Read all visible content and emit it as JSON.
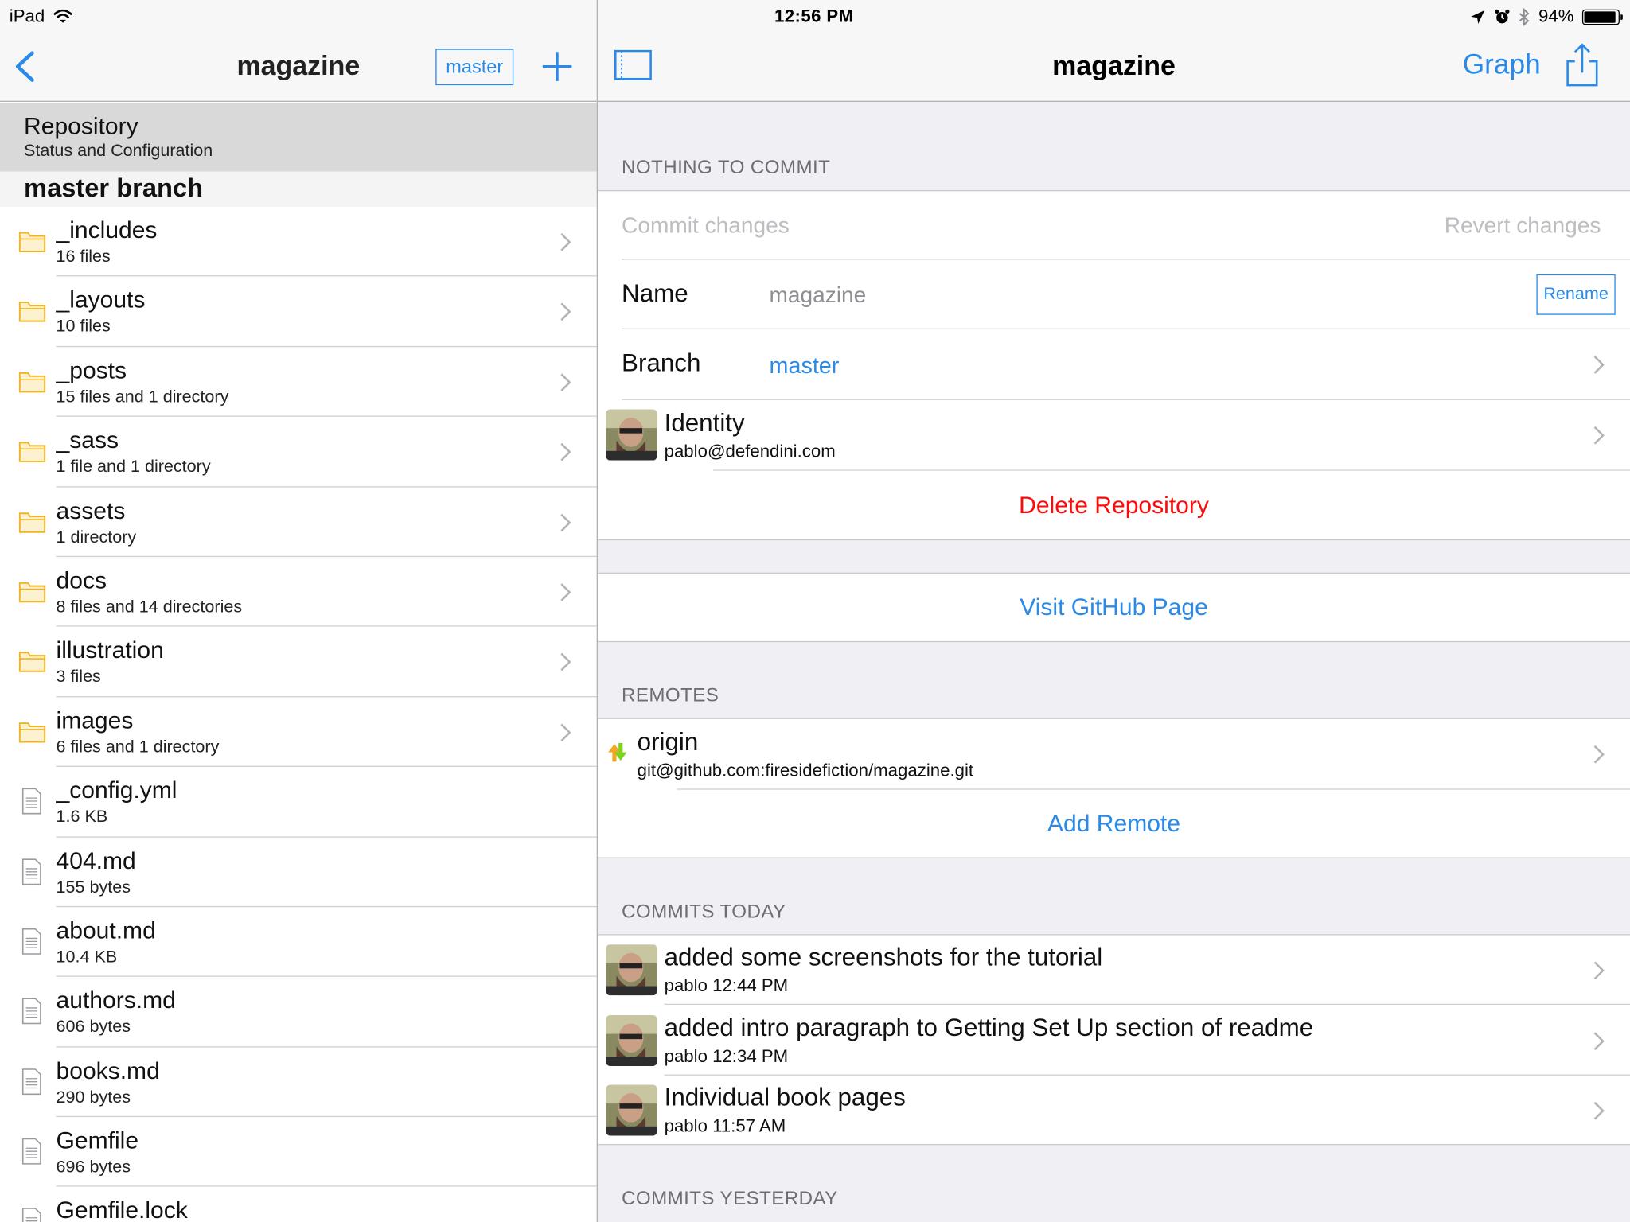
{
  "status_bar": {
    "device": "iPad",
    "time": "12:56 PM",
    "battery_percent": "94%",
    "battery_level": 0.94
  },
  "left_nav": {
    "title": "magazine",
    "branch_button": "master"
  },
  "repository_row": {
    "title": "Repository",
    "subtitle": "Status and Configuration"
  },
  "branch_section": {
    "heading": "master branch"
  },
  "files": [
    {
      "name": "_includes",
      "detail": "16 files",
      "type": "folder"
    },
    {
      "name": "_layouts",
      "detail": "10 files",
      "type": "folder"
    },
    {
      "name": "_posts",
      "detail": "15 files and 1 directory",
      "type": "folder"
    },
    {
      "name": "_sass",
      "detail": "1 file and 1 directory",
      "type": "folder"
    },
    {
      "name": "assets",
      "detail": "1 directory",
      "type": "folder"
    },
    {
      "name": "docs",
      "detail": "8 files and 14 directories",
      "type": "folder"
    },
    {
      "name": "illustration",
      "detail": "3 files",
      "type": "folder"
    },
    {
      "name": "images",
      "detail": "6 files and 1 directory",
      "type": "folder"
    },
    {
      "name": "_config.yml",
      "detail": "1.6 KB",
      "type": "file"
    },
    {
      "name": "404.md",
      "detail": "155 bytes",
      "type": "file"
    },
    {
      "name": "about.md",
      "detail": "10.4 KB",
      "type": "file"
    },
    {
      "name": "authors.md",
      "detail": "606 bytes",
      "type": "file"
    },
    {
      "name": "books.md",
      "detail": "290 bytes",
      "type": "file"
    },
    {
      "name": "Gemfile",
      "detail": "696 bytes",
      "type": "file"
    },
    {
      "name": "Gemfile.lock",
      "detail": "",
      "type": "file"
    }
  ],
  "right_nav": {
    "title": "magazine",
    "graph_button": "Graph"
  },
  "status_section": {
    "label": "NOTHING TO COMMIT",
    "commit_button": "Commit changes",
    "revert_button": "Revert changes",
    "name_label": "Name",
    "name_value": "magazine",
    "rename_button": "Rename",
    "branch_label": "Branch",
    "branch_value": "master",
    "identity_title": "Identity",
    "identity_email": "pablo@defendini.com",
    "delete_button": "Delete Repository"
  },
  "github_link": "Visit GitHub Page",
  "remotes_section": {
    "label": "REMOTES",
    "remote_name": "origin",
    "remote_url": "git@github.com:firesidefiction/magazine.git",
    "add_remote": "Add Remote"
  },
  "commits_today": {
    "label": "COMMITS TODAY",
    "commits": [
      {
        "message": "added some screenshots for the tutorial",
        "meta": "pablo 12:44 PM"
      },
      {
        "message": "added intro paragraph to Getting Set Up section of readme",
        "meta": "pablo 12:34 PM"
      },
      {
        "message": "Individual book pages",
        "meta": "pablo 11:57 AM"
      }
    ]
  },
  "commits_yesterday": {
    "label": "COMMITS YESTERDAY"
  },
  "colors": {
    "accent": "#2a8ae8",
    "destructive": "#ff0a0a",
    "folder": "#f5c242",
    "group_background": "#efeff4"
  }
}
